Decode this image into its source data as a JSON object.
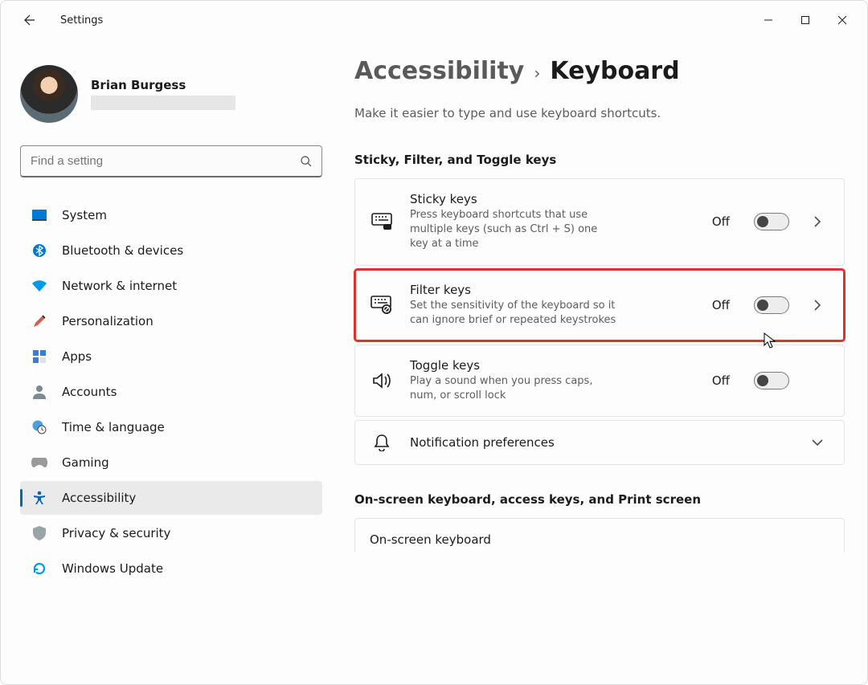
{
  "window": {
    "title": "Settings"
  },
  "user": {
    "name": "Brian Burgess"
  },
  "search": {
    "placeholder": "Find a setting"
  },
  "sidebar": {
    "items": [
      {
        "label": "System"
      },
      {
        "label": "Bluetooth & devices"
      },
      {
        "label": "Network & internet"
      },
      {
        "label": "Personalization"
      },
      {
        "label": "Apps"
      },
      {
        "label": "Accounts"
      },
      {
        "label": "Time & language"
      },
      {
        "label": "Gaming"
      },
      {
        "label": "Accessibility"
      },
      {
        "label": "Privacy & security"
      },
      {
        "label": "Windows Update"
      }
    ]
  },
  "breadcrumb": {
    "parent": "Accessibility",
    "current": "Keyboard"
  },
  "page": {
    "subtitle": "Make it easier to type and use keyboard shortcuts.",
    "section1_title": "Sticky, Filter, and Toggle keys",
    "sticky": {
      "title": "Sticky keys",
      "desc": "Press keyboard shortcuts that use multiple keys (such as Ctrl + S) one key at a time",
      "state": "Off"
    },
    "filter": {
      "title": "Filter keys",
      "desc": "Set the sensitivity of the keyboard so it can ignore brief or repeated keystrokes",
      "state": "Off"
    },
    "togglek": {
      "title": "Toggle keys",
      "desc": "Play a sound when you press caps, num, or scroll lock",
      "state": "Off"
    },
    "notif": {
      "title": "Notification preferences"
    },
    "section2_title": "On-screen keyboard, access keys, and Print screen",
    "osk": {
      "title": "On-screen keyboard"
    }
  }
}
